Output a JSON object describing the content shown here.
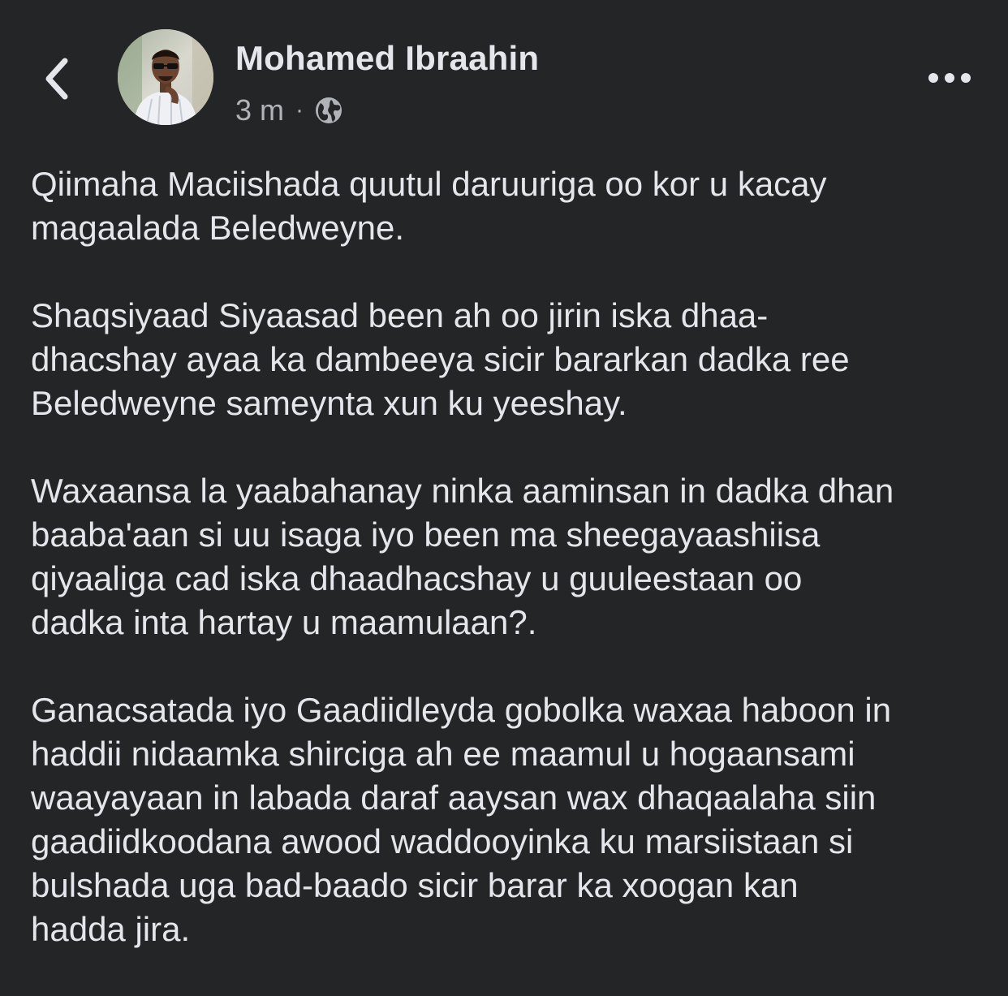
{
  "post": {
    "author": "Mohamed Ibraahin",
    "time": "3 m",
    "separator": "·",
    "privacy_icon": "globe-icon",
    "paragraphs": [
      {
        "lines": [
          "Qiimaha Maciishada quutul daruuriga oo kor u kacay",
          "magaalada Beledweyne."
        ]
      },
      {
        "lines": [
          "Shaqsiyaad Siyaasad been ah oo jirin iska dhaa-",
          "dhacshay ayaa ka dambeeya sicir bararkan dadka ree",
          "Beledweyne sameynta xun ku yeeshay."
        ]
      },
      {
        "lines": [
          "Waxaansa la yaabahanay ninka aaminsan in dadka dhan",
          "baaba'aan  si uu isaga iyo been ma sheegayaashiisa",
          "qiyaaliga cad iska dhaadhacshay u guuleestaan oo",
          "dadka inta hartay u maamulaan?."
        ]
      },
      {
        "lines": [
          "Ganacsatada iyo Gaadiidleyda gobolka waxaa haboon in",
          "haddii nidaamka shirciga ah ee maamul  u hogaansami",
          "waayayaan in labada daraf aaysan wax dhaqaalaha siin",
          "gaadiidkoodana awood waddooyinka ku marsiistaan si",
          "bulshada uga bad-baado sicir barar ka xoogan kan",
          "hadda jira."
        ]
      }
    ]
  },
  "icons": {
    "back": "chevron-left-icon",
    "more": "more-horizontal-icon"
  },
  "colors": {
    "background": "#242526",
    "primary_text": "#e4e6eb",
    "secondary_text": "#b0b3b8"
  }
}
